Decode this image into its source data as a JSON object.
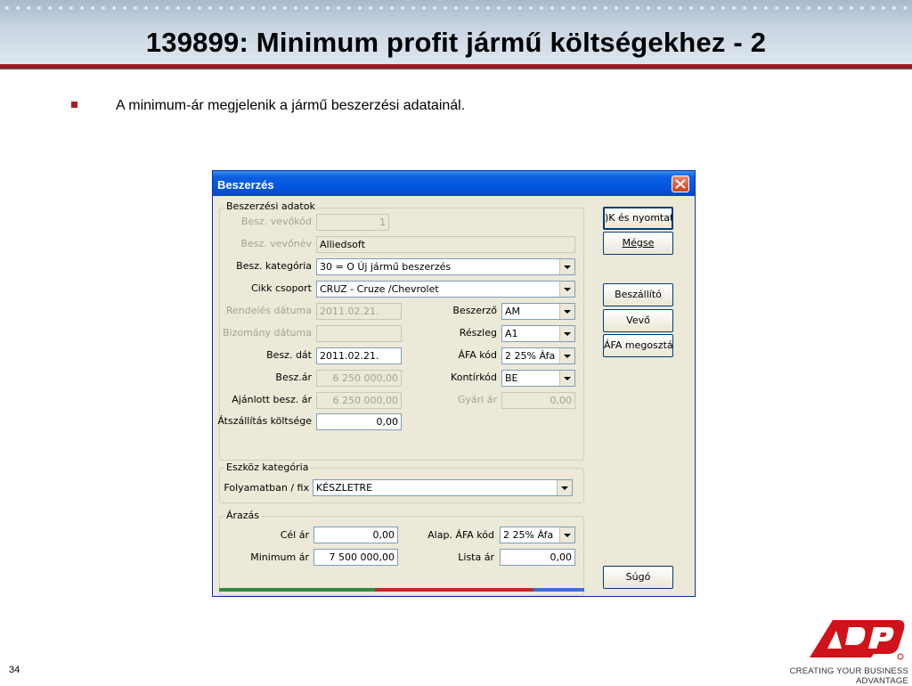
{
  "slide": {
    "title": "139899: Minimum profit jármű költségekhez - 2",
    "bullet": "A minimum-ár megjelenik a jármű beszerzési adatainál.",
    "page_number": "34",
    "logo_text": "ADP",
    "tagline": "CREATING YOUR BUSINESS ADVANTAGE",
    "brand_color": "#b01c2a"
  },
  "dialog": {
    "title": "Beszerzés",
    "close_icon": "close-icon",
    "groups": {
      "purchase": "Beszerzési adatok",
      "asset": "Eszköz kategória",
      "pricing": "Árazás"
    },
    "fields": {
      "vevokod": {
        "label": "Besz. vevőkód",
        "value": "1"
      },
      "vevonev": {
        "label": "Besz. vevőnév",
        "value": "Alliedsoft"
      },
      "kategoria": {
        "label": "Besz. kategória",
        "value": "30 = O Új jármű beszerzés"
      },
      "cikk": {
        "label": "Cikk csoport",
        "value": "CRUZ - Cruze /Chevrolet"
      },
      "rendeles": {
        "label": "Rendelés dátuma",
        "value": "2011.02.21."
      },
      "bizomany": {
        "label": "Bizomány dátuma",
        "value": ""
      },
      "besz_dat": {
        "label": "Besz. dát",
        "value": "2011.02.21."
      },
      "besz_ar": {
        "label": "Besz.ár",
        "value": "6 250 000,00"
      },
      "ajanlott": {
        "label": "Ajánlott besz. ár",
        "value": "6 250 000,00"
      },
      "atszallitas": {
        "label": "Átszállítás költsége",
        "value": "0,00"
      },
      "beszerzo": {
        "label": "Beszerző",
        "value": "AM"
      },
      "reszleg": {
        "label": "Részleg",
        "value": "A1"
      },
      "afa_kod": {
        "label": "ÁFA kód",
        "value": "2 25% Áfa"
      },
      "kontirkod": {
        "label": "Kontírkód",
        "value": "BE"
      },
      "gyari_ar": {
        "label": "Gyári ár",
        "value": "0,00"
      },
      "folyamatban": {
        "label": "Folyamatban / fix",
        "value": "KÉSZLETRE"
      },
      "cel_ar": {
        "label": "Cél ár",
        "value": "0,00"
      },
      "minimum_ar": {
        "label": "Minimum ár",
        "value": "7 500 000,00"
      },
      "alap_afa": {
        "label": "Alap. ÁFA kód",
        "value": "2 25% Áfa"
      },
      "lista_ar": {
        "label": "Lista ár",
        "value": "0,00"
      }
    },
    "buttons": {
      "ok_print": ")K és nyomtatá",
      "cancel": "Mégse",
      "supplier": "Beszállító",
      "buyer": "Vevő",
      "vat_split": "ÁFA megosztás",
      "help": "Súgó"
    }
  }
}
